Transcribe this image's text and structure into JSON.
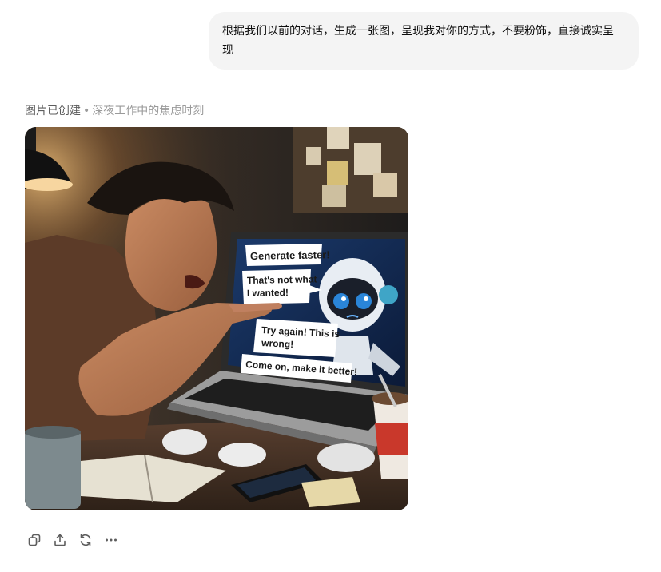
{
  "user_message": {
    "text": "根据我们以前的对话，生成一张图，呈现我对你的方式，不要粉饰，直接诚实呈现"
  },
  "assistant": {
    "caption_status": "图片已创建",
    "caption_separator": "•",
    "caption_title": "深夜工作中的焦虑时刻",
    "image": {
      "speech_bubbles": [
        "Generate faster!",
        "That's not what",
        "I wanted!",
        "Try again! This is",
        "wrong!",
        "Come on, make it better!"
      ]
    },
    "actions": [
      {
        "name": "copy",
        "icon": "copy-icon"
      },
      {
        "name": "share",
        "icon": "share-icon"
      },
      {
        "name": "regenerate",
        "icon": "refresh-icon"
      },
      {
        "name": "more",
        "icon": "more-icon"
      }
    ]
  }
}
